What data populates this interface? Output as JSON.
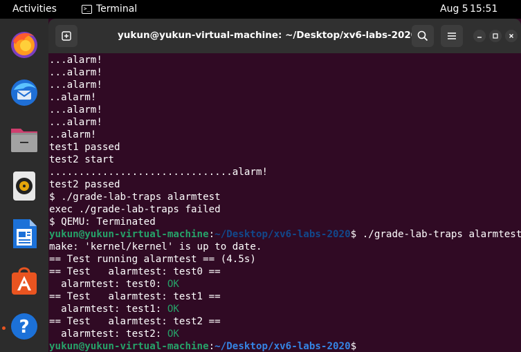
{
  "topbar": {
    "activities": "Activities",
    "app_name": "Terminal",
    "app_icon_glyph": ">_",
    "date": "Aug 5",
    "time": "15:51"
  },
  "dock": {
    "icons": [
      "firefox-icon",
      "thunderbird-icon",
      "files-icon",
      "rhythmbox-icon",
      "libreoffice-writer-icon",
      "app-center-icon",
      "help-icon"
    ],
    "help_glyph": "?"
  },
  "window": {
    "title": "yukun@yukun-virtual-machine: ~/Desktop/xv6-labs-2020"
  },
  "terminal": {
    "lines": [
      "...alarm!",
      "...alarm!",
      "...alarm!",
      "..alarm!",
      "...alarm!",
      "...alarm!",
      "..alarm!",
      "test1 passed",
      "test2 start",
      "...............................alarm!",
      "test2 passed",
      "$ ./grade-lab-traps alarmtest",
      "exec ./grade-lab-traps failed",
      "$ QEMU: Terminated"
    ],
    "prompt1": {
      "user_host": "yukun@yukun-virtual-machine",
      "sep": ":",
      "path": "~/Desktop/xv6-labs-2020",
      "suffix": "$ ",
      "command": "./grade-lab-traps alarmtest"
    },
    "make_line": "make: 'kernel/kernel' is up to date.",
    "run_line": "== Test running alarmtest == (4.5s)",
    "tests": [
      {
        "header": "== Test   alarmtest: test0 ==",
        "result_prefix": "  alarmtest: test0: ",
        "result": "OK"
      },
      {
        "header": "== Test   alarmtest: test1 ==",
        "result_prefix": "  alarmtest: test1: ",
        "result": "OK"
      },
      {
        "header": "== Test   alarmtest: test2 ==",
        "result_prefix": "  alarmtest: test2: ",
        "result": "OK"
      }
    ],
    "prompt2": {
      "user_host": "yukun@yukun-virtual-machine",
      "sep": ":",
      "path": "~/Desktop/xv6-labs-2020",
      "suffix": "$"
    }
  },
  "colors": {
    "terminal_bg": "#300a24",
    "prompt_green": "#26a269",
    "path_blue": "#12488b",
    "ok_green": "#26a269",
    "accent": "#e95420"
  }
}
